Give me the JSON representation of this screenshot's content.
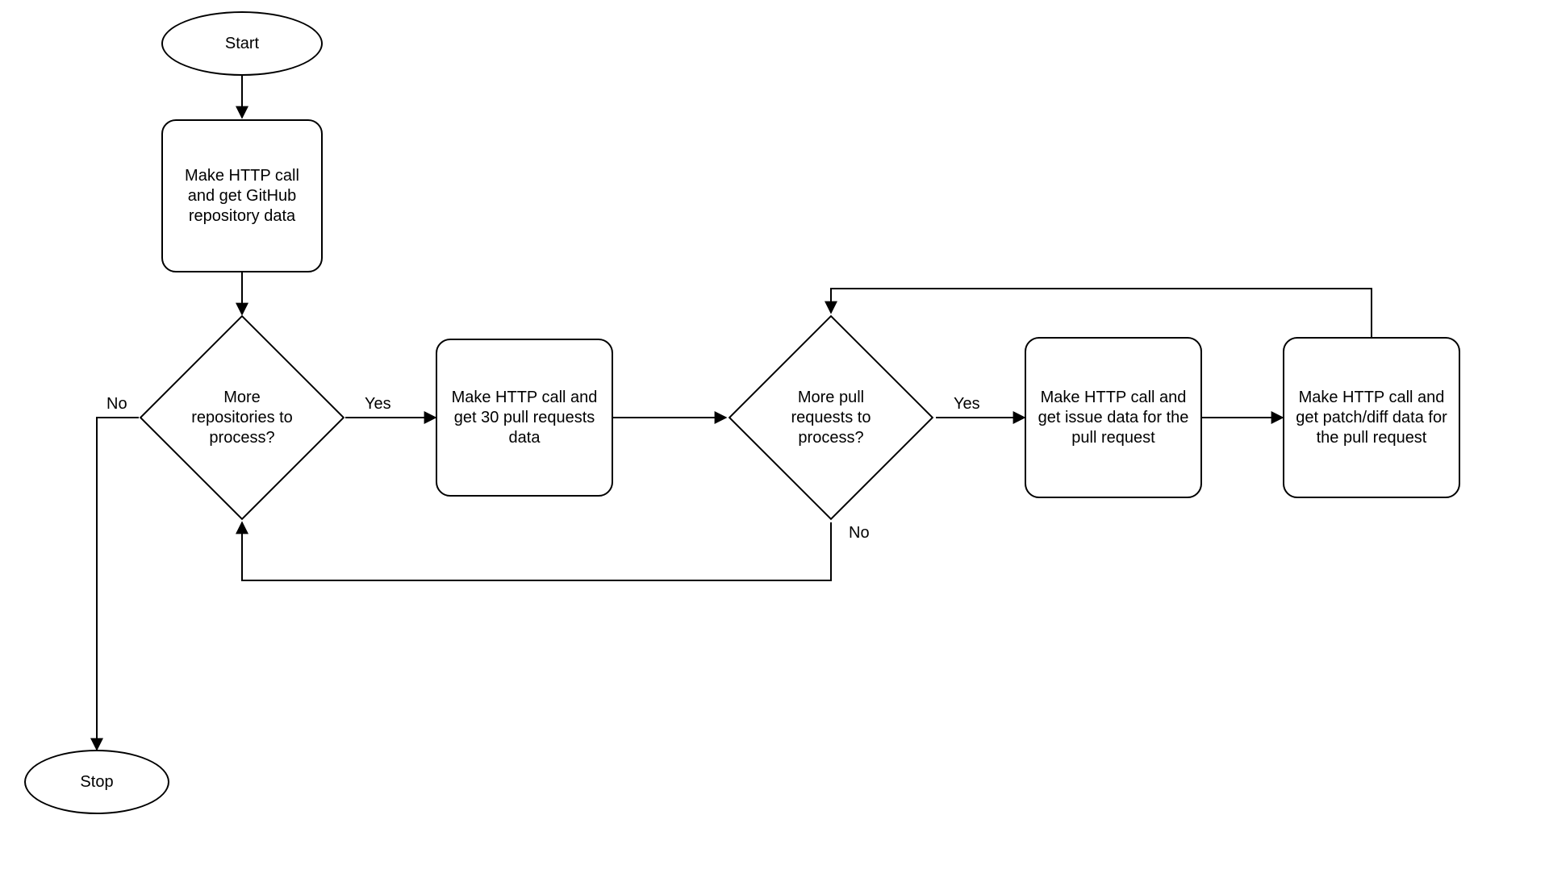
{
  "nodes": {
    "start": "Start",
    "stop": "Stop",
    "getRepos": "Make HTTP call and get GitHub repository data",
    "moreRepos": "More repositories to process?",
    "getPRs": "Make HTTP call and get 30 pull requests data",
    "morePRs": "More pull requests to process?",
    "getIssue": "Make HTTP call and get issue data for the pull request",
    "getPatch": "Make HTTP call and get patch/diff data for the pull request"
  },
  "edgeLabels": {
    "yes": "Yes",
    "no": "No"
  }
}
